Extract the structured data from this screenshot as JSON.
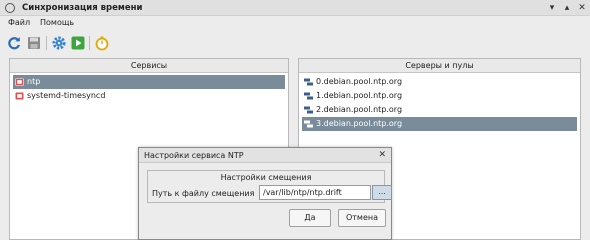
{
  "window": {
    "title": "Синхронизация времени",
    "controls": [
      "▾",
      "▴",
      "✕"
    ]
  },
  "menu": [
    {
      "label": "Файл"
    },
    {
      "label": "Помощь"
    }
  ],
  "toolbar": {
    "buttons": [
      {
        "name": "refresh-icon",
        "color": "#2a6db3"
      },
      {
        "name": "save-icon",
        "color": "#777777"
      },
      {
        "name": "gear-icon",
        "color": "#2f7fd0"
      },
      {
        "name": "play-icon",
        "color": "#3da53d"
      },
      {
        "name": "timer-icon",
        "color": "#e0a800"
      }
    ]
  },
  "services_panel": {
    "header": "Сервисы",
    "items": [
      {
        "label": "ntp",
        "selected": true
      },
      {
        "label": "systemd-timesyncd",
        "selected": false
      }
    ]
  },
  "servers_panel": {
    "header": "Серверы и пулы",
    "items": [
      {
        "label": "0.debian.pool.ntp.org",
        "selected": false
      },
      {
        "label": "1.debian.pool.ntp.org",
        "selected": false
      },
      {
        "label": "2.debian.pool.ntp.org",
        "selected": false
      },
      {
        "label": "3.debian.pool.ntp.org",
        "selected": true
      }
    ]
  },
  "dialog": {
    "title": "Настройки сервиса NTP",
    "close": "✕",
    "group_title": "Настройки смещения",
    "field_label": "Путь к файлу смещения",
    "field_value": "/var/lib/ntp/ntp.drift",
    "browse_label": "...",
    "ok_label": "Да",
    "cancel_label": "Отмена"
  },
  "colors": {
    "selection": "#7a8b9a",
    "service_icon": "#d9534f",
    "server_icon": "#3a5f8a"
  }
}
